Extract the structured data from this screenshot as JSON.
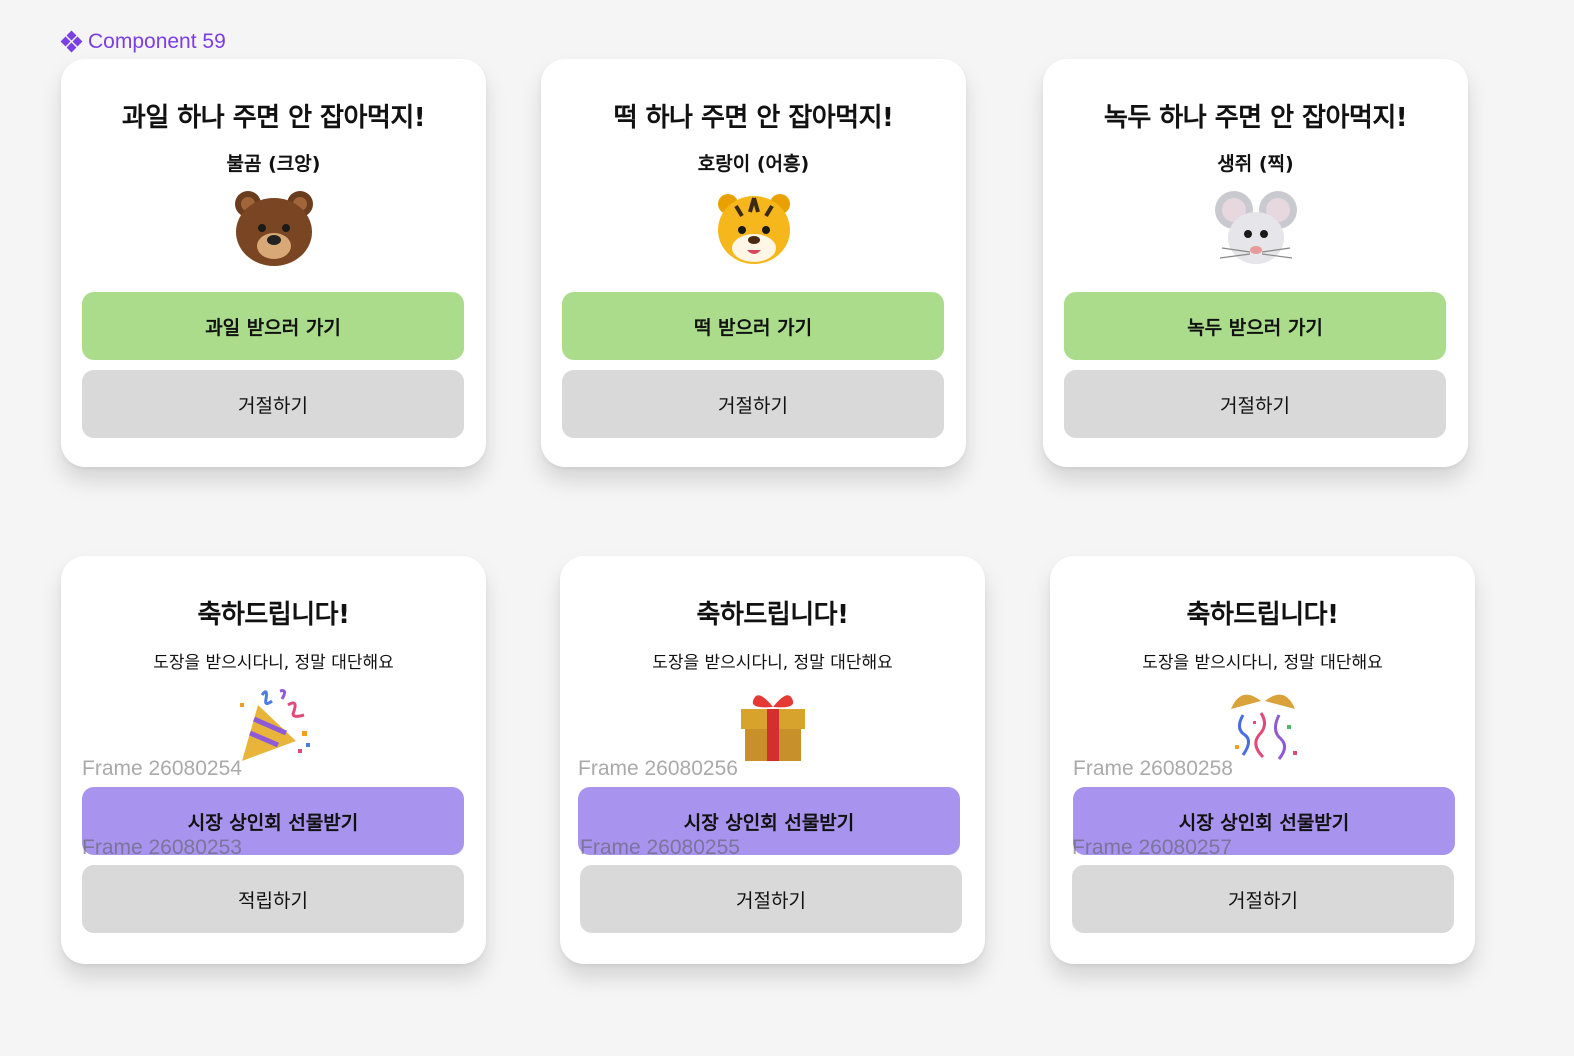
{
  "component": {
    "label": "Component 59",
    "icon": "component-icon"
  },
  "row1": [
    {
      "title": "과일 하나 주면 안 잡아먹지!",
      "subtitle": "불곰 (크앙)",
      "emoji": "bear-face",
      "primary": "과일 받으러 가기",
      "secondary": "거절하기"
    },
    {
      "title": "떡 하나 주면 안 잡아먹지!",
      "subtitle": "호랑이 (어흥)",
      "emoji": "tiger-face",
      "primary": "떡 받으러 가기",
      "secondary": "거절하기"
    },
    {
      "title": "녹두 하나 주면 안 잡아먹지!",
      "subtitle": "생쥐 (찍)",
      "emoji": "mouse-face",
      "primary": "녹두 받으러 가기",
      "secondary": "거절하기"
    }
  ],
  "row2": [
    {
      "title": "축하드립니다!",
      "subtitle": "도장을 받으시다니, 정말 대단해요",
      "emoji": "party-popper",
      "frame_top": "Frame 26080254",
      "primary": "시장 상인회 선물받기",
      "frame_bottom": "Frame 26080253",
      "secondary": "적립하기"
    },
    {
      "title": "축하드립니다!",
      "subtitle": "도장을 받으시다니, 정말 대단해요",
      "emoji": "wrapped-gift",
      "frame_top": "Frame 26080256",
      "primary": "시장 상인회 선물받기",
      "frame_bottom": "Frame 26080255",
      "secondary": "거절하기"
    },
    {
      "title": "축하드립니다!",
      "subtitle": "도장을 받으시다니, 정말 대단해요",
      "emoji": "confetti-ball",
      "frame_top": "Frame 26080258",
      "primary": "시장 상인회 선물받기",
      "frame_bottom": "Frame 26080257",
      "secondary": "거절하기"
    }
  ],
  "colors": {
    "accent_purple": "#7b3fe4",
    "button_green": "#aadc8c",
    "button_purple": "#a894ee",
    "button_gray": "#d9d9d9"
  }
}
